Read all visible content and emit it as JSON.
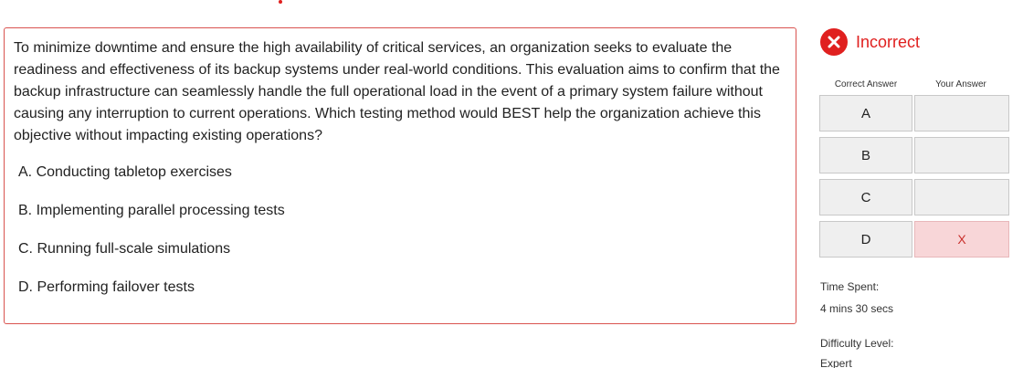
{
  "question": {
    "text": "To minimize downtime and ensure the high availability of critical services, an organization seeks to evaluate the readiness and effectiveness of its backup systems under real-world conditions. This evaluation aims to confirm that the backup infrastructure can seamlessly handle the full operational load in the event of a primary system failure without causing any interruption to current operations. Which testing method would BEST help the organization achieve this objective without impacting existing operations?",
    "options": [
      "A. Conducting tabletop exercises",
      "B. Implementing parallel processing tests",
      "C. Running full-scale simulations",
      "D. Performing failover tests"
    ]
  },
  "result": {
    "status": "Incorrect",
    "status_color": "#e0201f",
    "icon": "close-icon"
  },
  "answer_grid": {
    "correct_header": "Correct Answer",
    "yours_header": "Your Answer",
    "rows": [
      {
        "correct": "A",
        "yours": ""
      },
      {
        "correct": "B",
        "yours": ""
      },
      {
        "correct": "C",
        "yours": ""
      },
      {
        "correct": "D",
        "yours": "X"
      }
    ]
  },
  "stats": {
    "time_label": "Time Spent:",
    "time_value": "4 mins 30 secs",
    "difficulty_label": "Difficulty Level:",
    "difficulty_value": "Expert"
  }
}
